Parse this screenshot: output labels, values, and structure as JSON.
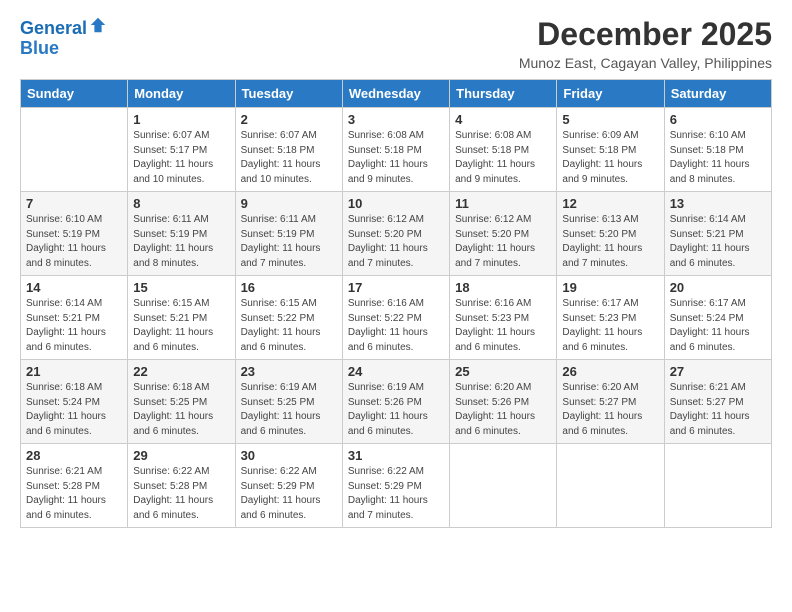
{
  "logo": {
    "line1": "General",
    "line2": "Blue"
  },
  "title": "December 2025",
  "location": "Munoz East, Cagayan Valley, Philippines",
  "days_of_week": [
    "Sunday",
    "Monday",
    "Tuesday",
    "Wednesday",
    "Thursday",
    "Friday",
    "Saturday"
  ],
  "weeks": [
    [
      {
        "day": "",
        "info": ""
      },
      {
        "day": "1",
        "info": "Sunrise: 6:07 AM\nSunset: 5:17 PM\nDaylight: 11 hours\nand 10 minutes."
      },
      {
        "day": "2",
        "info": "Sunrise: 6:07 AM\nSunset: 5:18 PM\nDaylight: 11 hours\nand 10 minutes."
      },
      {
        "day": "3",
        "info": "Sunrise: 6:08 AM\nSunset: 5:18 PM\nDaylight: 11 hours\nand 9 minutes."
      },
      {
        "day": "4",
        "info": "Sunrise: 6:08 AM\nSunset: 5:18 PM\nDaylight: 11 hours\nand 9 minutes."
      },
      {
        "day": "5",
        "info": "Sunrise: 6:09 AM\nSunset: 5:18 PM\nDaylight: 11 hours\nand 9 minutes."
      },
      {
        "day": "6",
        "info": "Sunrise: 6:10 AM\nSunset: 5:18 PM\nDaylight: 11 hours\nand 8 minutes."
      }
    ],
    [
      {
        "day": "7",
        "info": "Sunrise: 6:10 AM\nSunset: 5:19 PM\nDaylight: 11 hours\nand 8 minutes."
      },
      {
        "day": "8",
        "info": "Sunrise: 6:11 AM\nSunset: 5:19 PM\nDaylight: 11 hours\nand 8 minutes."
      },
      {
        "day": "9",
        "info": "Sunrise: 6:11 AM\nSunset: 5:19 PM\nDaylight: 11 hours\nand 7 minutes."
      },
      {
        "day": "10",
        "info": "Sunrise: 6:12 AM\nSunset: 5:20 PM\nDaylight: 11 hours\nand 7 minutes."
      },
      {
        "day": "11",
        "info": "Sunrise: 6:12 AM\nSunset: 5:20 PM\nDaylight: 11 hours\nand 7 minutes."
      },
      {
        "day": "12",
        "info": "Sunrise: 6:13 AM\nSunset: 5:20 PM\nDaylight: 11 hours\nand 7 minutes."
      },
      {
        "day": "13",
        "info": "Sunrise: 6:14 AM\nSunset: 5:21 PM\nDaylight: 11 hours\nand 6 minutes."
      }
    ],
    [
      {
        "day": "14",
        "info": "Sunrise: 6:14 AM\nSunset: 5:21 PM\nDaylight: 11 hours\nand 6 minutes."
      },
      {
        "day": "15",
        "info": "Sunrise: 6:15 AM\nSunset: 5:21 PM\nDaylight: 11 hours\nand 6 minutes."
      },
      {
        "day": "16",
        "info": "Sunrise: 6:15 AM\nSunset: 5:22 PM\nDaylight: 11 hours\nand 6 minutes."
      },
      {
        "day": "17",
        "info": "Sunrise: 6:16 AM\nSunset: 5:22 PM\nDaylight: 11 hours\nand 6 minutes."
      },
      {
        "day": "18",
        "info": "Sunrise: 6:16 AM\nSunset: 5:23 PM\nDaylight: 11 hours\nand 6 minutes."
      },
      {
        "day": "19",
        "info": "Sunrise: 6:17 AM\nSunset: 5:23 PM\nDaylight: 11 hours\nand 6 minutes."
      },
      {
        "day": "20",
        "info": "Sunrise: 6:17 AM\nSunset: 5:24 PM\nDaylight: 11 hours\nand 6 minutes."
      }
    ],
    [
      {
        "day": "21",
        "info": "Sunrise: 6:18 AM\nSunset: 5:24 PM\nDaylight: 11 hours\nand 6 minutes."
      },
      {
        "day": "22",
        "info": "Sunrise: 6:18 AM\nSunset: 5:25 PM\nDaylight: 11 hours\nand 6 minutes."
      },
      {
        "day": "23",
        "info": "Sunrise: 6:19 AM\nSunset: 5:25 PM\nDaylight: 11 hours\nand 6 minutes."
      },
      {
        "day": "24",
        "info": "Sunrise: 6:19 AM\nSunset: 5:26 PM\nDaylight: 11 hours\nand 6 minutes."
      },
      {
        "day": "25",
        "info": "Sunrise: 6:20 AM\nSunset: 5:26 PM\nDaylight: 11 hours\nand 6 minutes."
      },
      {
        "day": "26",
        "info": "Sunrise: 6:20 AM\nSunset: 5:27 PM\nDaylight: 11 hours\nand 6 minutes."
      },
      {
        "day": "27",
        "info": "Sunrise: 6:21 AM\nSunset: 5:27 PM\nDaylight: 11 hours\nand 6 minutes."
      }
    ],
    [
      {
        "day": "28",
        "info": "Sunrise: 6:21 AM\nSunset: 5:28 PM\nDaylight: 11 hours\nand 6 minutes."
      },
      {
        "day": "29",
        "info": "Sunrise: 6:22 AM\nSunset: 5:28 PM\nDaylight: 11 hours\nand 6 minutes."
      },
      {
        "day": "30",
        "info": "Sunrise: 6:22 AM\nSunset: 5:29 PM\nDaylight: 11 hours\nand 6 minutes."
      },
      {
        "day": "31",
        "info": "Sunrise: 6:22 AM\nSunset: 5:29 PM\nDaylight: 11 hours\nand 7 minutes."
      },
      {
        "day": "",
        "info": ""
      },
      {
        "day": "",
        "info": ""
      },
      {
        "day": "",
        "info": ""
      }
    ]
  ]
}
